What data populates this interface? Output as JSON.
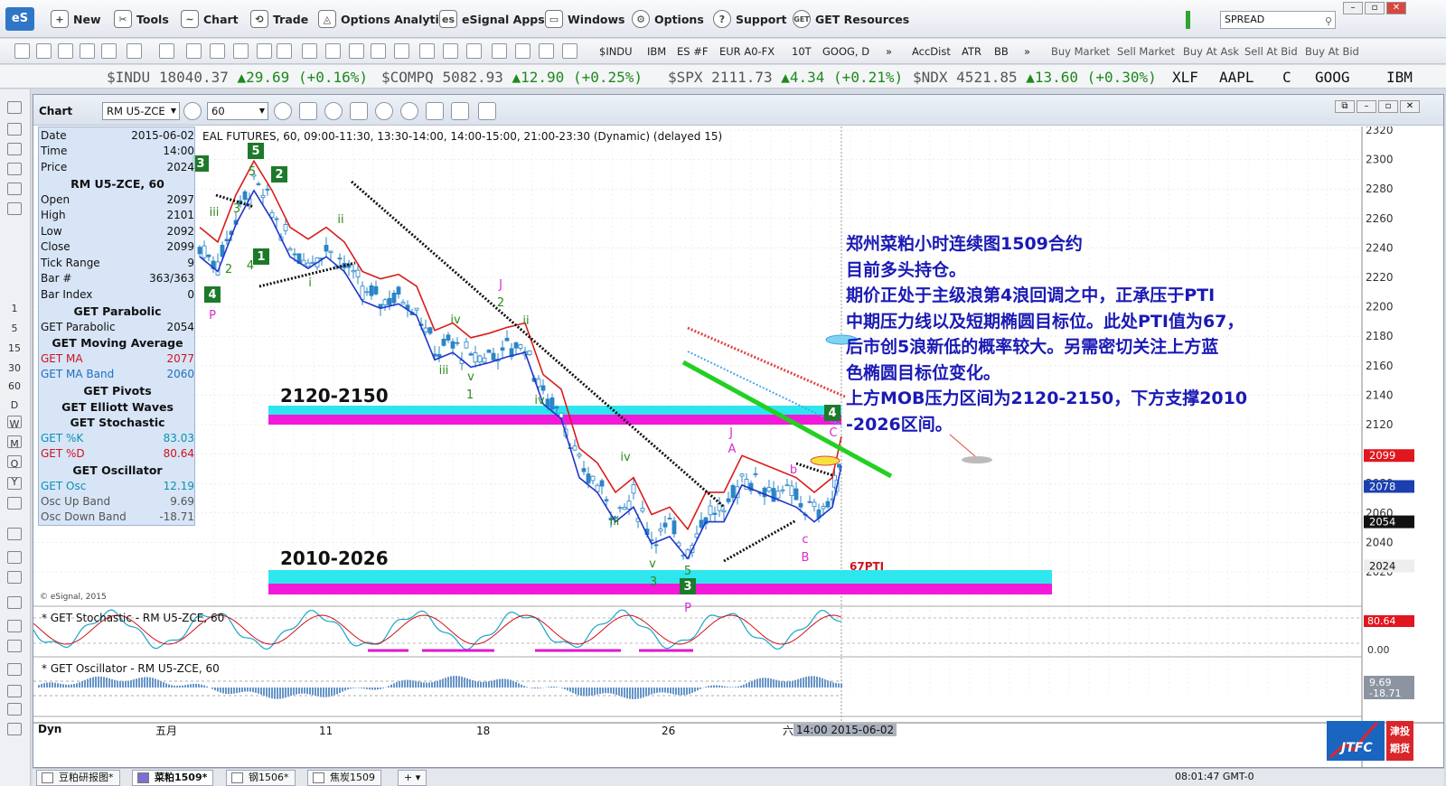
{
  "menu": {
    "logo": "eS",
    "items": [
      "New",
      "Tools",
      "Chart",
      "Trade",
      "Options Analytix",
      "eSignal Apps",
      "Windows",
      "Options",
      "Support",
      "GET Resources"
    ],
    "search_value": "SPREAD"
  },
  "toolbar": {
    "symbols": [
      "$INDU",
      "IBM",
      "ES #F",
      "EUR A0-FX",
      "10T",
      "GOOG, D",
      "»",
      "AccDist",
      "ATR",
      "BB",
      "»"
    ],
    "actions": [
      "Buy Market",
      "Sell Market",
      "Buy At Ask",
      "Sell At Bid",
      "Buy At Bid"
    ]
  },
  "ticker": [
    {
      "sym": "$INDU",
      "price": "18040.37",
      "chg": "▲29.69 (+0.16%)"
    },
    {
      "sym": "$COMPQ",
      "price": "5082.93",
      "chg": "▲12.90 (+0.25%)"
    },
    {
      "sym": "$SPX",
      "price": "2111.73",
      "chg": "▲4.34 (+0.21%)"
    },
    {
      "sym": "$NDX",
      "price": "4521.85",
      "chg": "▲13.60 (+0.30%)"
    },
    {
      "sym": "XLF",
      "price": "",
      "chg": ""
    },
    {
      "sym": "AAPL",
      "price": "",
      "chg": ""
    },
    {
      "sym": "C",
      "price": "",
      "chg": ""
    },
    {
      "sym": "GOOG",
      "price": "",
      "chg": ""
    },
    {
      "sym": "IBM",
      "price": "",
      "chg": ""
    }
  ],
  "left_tools": [
    "1",
    "5",
    "15",
    "30",
    "60",
    "D",
    "W",
    "M",
    "Q",
    "Y"
  ],
  "chart": {
    "title": "Chart",
    "symbol": "RM U5-ZCE",
    "interval": "60",
    "header_info": "EAL FUTURES, 60, 09:00-11:30, 13:30-14:00, 14:00-15:00, 21:00-23:30 (Dynamic) (delayed 15)",
    "copyright": "© eSignal, 2015",
    "data_window": {
      "rows1": [
        [
          "Date",
          "2015-06-02"
        ],
        [
          "Time",
          "14:00"
        ],
        [
          "Price",
          "2024"
        ]
      ],
      "sym": "RM U5-ZCE, 60",
      "rows2": [
        [
          "Open",
          "2097"
        ],
        [
          "High",
          "2101"
        ],
        [
          "Low",
          "2092"
        ],
        [
          "Close",
          "2099"
        ],
        [
          "Tick Range",
          "9"
        ],
        [
          "Bar #",
          "363/363"
        ],
        [
          "Bar Index",
          "0"
        ]
      ],
      "h_parabolic": "GET Parabolic",
      "parabolic": [
        "GET Parabolic",
        "2054"
      ],
      "h_ma": "GET Moving Average",
      "ma": [
        "GET MA",
        "2077"
      ],
      "ma_band": [
        "GET MA Band",
        "2060"
      ],
      "h_pivots": "GET Pivots",
      "h_ew": "GET Elliott Waves",
      "h_stoch": "GET Stochastic",
      "k": [
        "GET %K",
        "83.03"
      ],
      "d": [
        "GET %D",
        "80.64"
      ],
      "h_osc": "GET Oscillator",
      "osc": [
        "GET Osc",
        "12.19"
      ],
      "osc_up": [
        "Osc Up Band",
        "9.69"
      ],
      "osc_down": [
        "Osc Down Band",
        "-18.71"
      ]
    },
    "level_upper": "2120-2150",
    "level_lower": "2010-2026",
    "annotation": [
      "郑州菜粕小时连续图1509合约",
      "目前多头持仓。",
      "期价正处于主级浪第4浪回调之中，正承压于PTI",
      "中期压力线以及短期椭圆目标位。此处PTI值为67，",
      "后市创5浪新低的概率较大。另需密切关注上方蓝",
      "色椭圆目标位变化。",
      "上方MOB压力区间为2120-2150，下方支撑2010",
      "-2026区间。"
    ],
    "pti_label": "67PTI",
    "y_axis": [
      "2320",
      "2300",
      "2280",
      "2260",
      "2240",
      "2220",
      "2200",
      "2180",
      "2160",
      "2140",
      "2120",
      "2100",
      "2080",
      "2060",
      "2040",
      "2020"
    ],
    "price_tags": [
      {
        "v": "2099",
        "c": "#e0171f"
      },
      {
        "v": "2078",
        "c": "#1b3fb0"
      },
      {
        "v": "2054",
        "c": "#111"
      },
      {
        "v": "2024",
        "c": "#eee"
      }
    ],
    "stoch_title": "* GET Stochastic - RM U5-ZCE, 60",
    "stoch_axis": [
      "80.64",
      "0.00"
    ],
    "osc_title": "* GET Oscillator - RM U5-ZCE, 60",
    "osc_axis": [
      "9.69",
      "-18.71"
    ],
    "x_axis": [
      "五月",
      "11",
      "18",
      "26",
      "六"
    ],
    "x_cursor": "14:00 2015-06-02",
    "dyn": "Dyn",
    "wave_labels": [
      "5",
      "5",
      "2",
      "4",
      "3",
      "1",
      "2",
      "4",
      "P",
      "3",
      "i",
      "ii",
      "iii",
      "iv",
      "v",
      "1",
      "J",
      "2",
      "iv",
      "iii",
      "v",
      "3",
      "5",
      "3",
      "P",
      "J",
      "A",
      "b",
      "c",
      "B",
      "C",
      "4",
      "ii",
      "iii",
      "iv"
    ]
  },
  "bottom_tabs": [
    "豆粕研报图*",
    "菜粕1509*",
    "钢1506*",
    "焦炭1509"
  ],
  "clock": "08:01:47 GMT-0",
  "brand": {
    "en": "JTFC",
    "cn": "津投期货"
  }
}
